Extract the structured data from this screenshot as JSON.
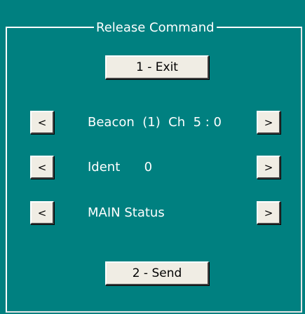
{
  "frame": {
    "title": "Release Command"
  },
  "buttons": {
    "exit_label": "1 - Exit",
    "send_label": "2 - Send",
    "prev_glyph": "<",
    "next_glyph": ">"
  },
  "rows": [
    {
      "text": "Beacon  (1)  Ch  5 : 0"
    },
    {
      "text": "Ident      0"
    },
    {
      "text": "MAIN Status"
    }
  ],
  "colors": {
    "panel_background": "#008080",
    "button_face": "#f0ede4",
    "text": "#ffffff"
  }
}
